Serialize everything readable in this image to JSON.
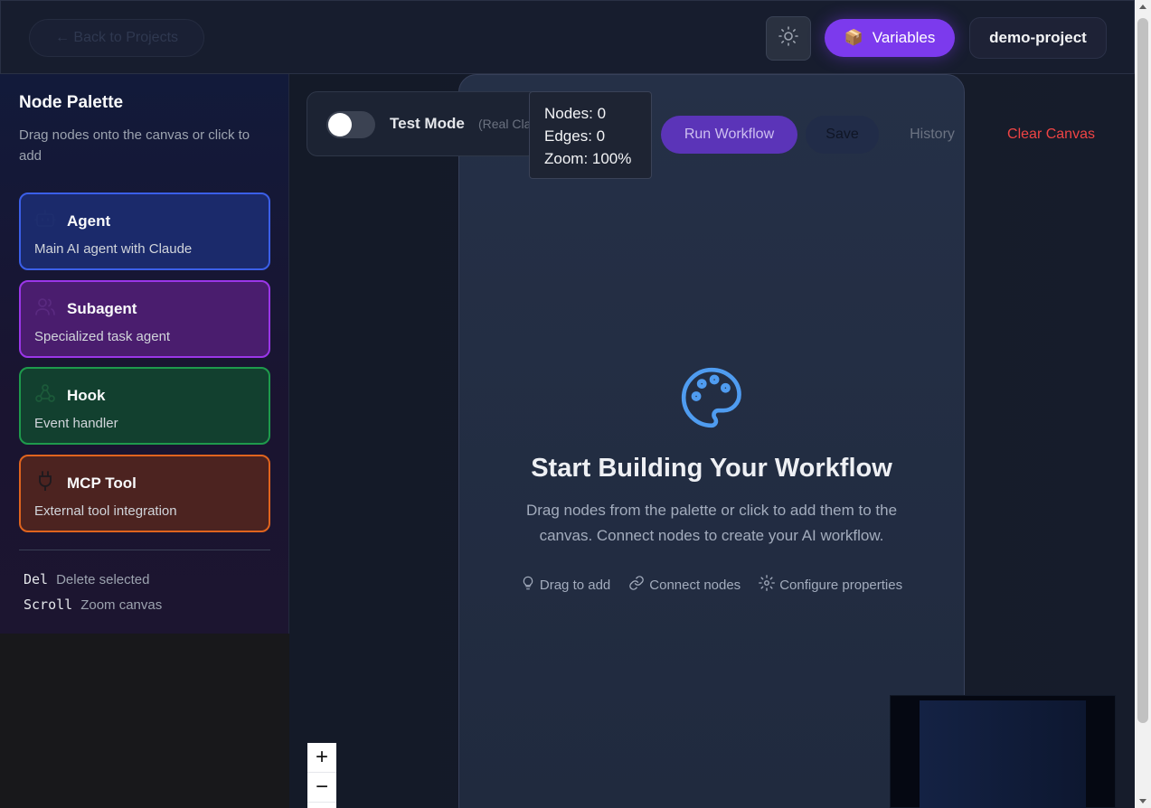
{
  "header": {
    "back_label": "← Back to Projects",
    "variables_icon": "📦",
    "variables_label": "Variables",
    "project_name": "demo-project",
    "theme_icon": "sun-icon"
  },
  "sidebar": {
    "title": "Node Palette",
    "subtitle": "Drag nodes onto the canvas or click to add",
    "nodes": [
      {
        "name": "Agent",
        "desc": "Main AI agent with Claude",
        "icon": "bot-icon"
      },
      {
        "name": "Subagent",
        "desc": "Specialized task agent",
        "icon": "users-icon"
      },
      {
        "name": "Hook",
        "desc": "Event handler",
        "icon": "webhook-icon"
      },
      {
        "name": "MCP Tool",
        "desc": "External tool integration",
        "icon": "plug-icon"
      }
    ],
    "shortcuts": [
      {
        "key": "Del",
        "label": "Delete selected"
      },
      {
        "key": "Scroll",
        "label": "Zoom canvas"
      }
    ]
  },
  "toolbar": {
    "test_mode_label": "Test Mode",
    "test_mode_sub": "(Real Claude)",
    "test_mode_on": false,
    "run_label": "Run Workflow",
    "save_label": "Save",
    "history_label": "History",
    "clear_label": "Clear Canvas"
  },
  "stats": {
    "nodes": "Nodes: 0",
    "edges": "Edges: 0",
    "zoom": "Zoom: 100%"
  },
  "empty_state": {
    "icon": "palette-icon",
    "title": "Start Building Your Workflow",
    "description": "Drag nodes from the palette or click to add them to the canvas. Connect nodes to create your AI workflow.",
    "hints": [
      {
        "icon": "lightbulb-icon",
        "label": "Drag to add"
      },
      {
        "icon": "link-icon",
        "label": "Connect nodes"
      },
      {
        "icon": "gear-icon",
        "label": "Configure properties"
      }
    ]
  },
  "zoom_controls": {
    "zoom_in": "+",
    "zoom_out": "−"
  },
  "colors": {
    "accent": "#7c3aed",
    "agent": "#3b5fe8",
    "subagent": "#9b36e8",
    "hook": "#1e9a4c",
    "mcp": "#e0641e",
    "danger": "#ef4444",
    "palette_icon": "#4f9cf0"
  }
}
